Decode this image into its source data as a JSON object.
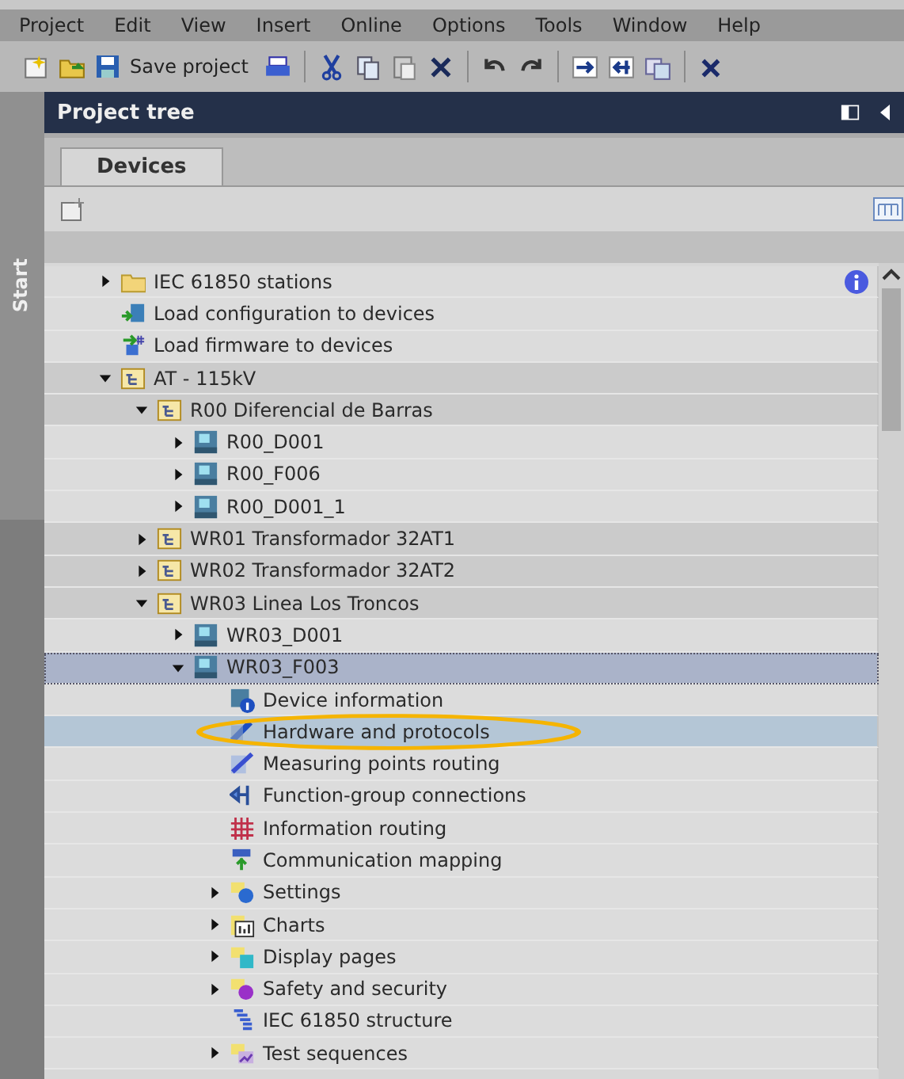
{
  "menu": [
    "Project",
    "Edit",
    "View",
    "Insert",
    "Online",
    "Options",
    "Tools",
    "Window",
    "Help"
  ],
  "toolbar": [
    {
      "kind": "new"
    },
    {
      "kind": "open"
    },
    {
      "kind": "save",
      "label": "Save project"
    },
    {
      "kind": "print"
    },
    {
      "kind": "sep"
    },
    {
      "kind": "cut"
    },
    {
      "kind": "copy"
    },
    {
      "kind": "paste"
    },
    {
      "kind": "delete"
    },
    {
      "kind": "sep"
    },
    {
      "kind": "undo"
    },
    {
      "kind": "redo"
    },
    {
      "kind": "sep"
    },
    {
      "kind": "online"
    },
    {
      "kind": "offline"
    },
    {
      "kind": "devices"
    },
    {
      "kind": "sep"
    },
    {
      "kind": "close"
    }
  ],
  "side_tab": "Start",
  "panel": {
    "title": "Project tree"
  },
  "tabs": [
    {
      "label": "Devices",
      "selected": true
    }
  ],
  "tree": [
    {
      "label": "IEC 61850 stations",
      "kind": "folder",
      "expanded": false,
      "selected": false,
      "hovered": false,
      "circled": false
    },
    {
      "label": "Load configuration to devices",
      "kind": "load-config",
      "selected": false,
      "hovered": false,
      "circled": false
    },
    {
      "label": "Load firmware to devices",
      "kind": "load-firmware",
      "selected": false,
      "hovered": false,
      "circled": false
    },
    {
      "label": "AT - 115kV",
      "kind": "group",
      "expanded": true,
      "selected": false,
      "hovered": false,
      "circled": false,
      "children": [
        {
          "label": "R00 Diferencial de Barras",
          "kind": "group",
          "expanded": true,
          "selected": false,
          "hovered": false,
          "circled": false,
          "children": [
            {
              "label": "R00_D001",
              "kind": "device",
              "expanded": false,
              "selected": false,
              "hovered": false,
              "circled": false
            },
            {
              "label": "R00_F006",
              "kind": "device",
              "expanded": false,
              "selected": false,
              "hovered": false,
              "circled": false
            },
            {
              "label": "R00_D001_1",
              "kind": "device",
              "expanded": false,
              "selected": false,
              "hovered": false,
              "circled": false
            }
          ]
        },
        {
          "label": "WR01 Transformador 32AT1",
          "kind": "group",
          "expanded": false,
          "selected": false,
          "hovered": false,
          "circled": false
        },
        {
          "label": "WR02 Transformador 32AT2",
          "kind": "group",
          "expanded": false,
          "selected": false,
          "hovered": false,
          "circled": false
        },
        {
          "label": "WR03 Linea Los Troncos",
          "kind": "group",
          "expanded": true,
          "selected": false,
          "hovered": false,
          "circled": false,
          "children": [
            {
              "label": "WR03_D001",
              "kind": "device",
              "expanded": false,
              "selected": false,
              "hovered": false,
              "circled": false
            },
            {
              "label": "WR03_F003",
              "kind": "device",
              "expanded": true,
              "selected": true,
              "hovered": false,
              "circled": false,
              "children": [
                {
                  "label": "Device information",
                  "kind": "device-info",
                  "selected": false,
                  "hovered": false,
                  "circled": false
                },
                {
                  "label": "Hardware and protocols",
                  "kind": "hardware",
                  "selected": false,
                  "hovered": true,
                  "circled": true
                },
                {
                  "label": "Measuring points routing",
                  "kind": "measuring",
                  "selected": false,
                  "hovered": false,
                  "circled": false
                },
                {
                  "label": "Function-group connections",
                  "kind": "function",
                  "selected": false,
                  "hovered": false,
                  "circled": false
                },
                {
                  "label": "Information routing",
                  "kind": "routing",
                  "selected": false,
                  "hovered": false,
                  "circled": false
                },
                {
                  "label": "Communication mapping",
                  "kind": "mapping",
                  "selected": false,
                  "hovered": false,
                  "circled": false
                },
                {
                  "label": "Settings",
                  "kind": "settings",
                  "expanded": false,
                  "selected": false,
                  "hovered": false,
                  "circled": false
                },
                {
                  "label": "Charts",
                  "kind": "charts",
                  "expanded": false,
                  "selected": false,
                  "hovered": false,
                  "circled": false
                },
                {
                  "label": "Display pages",
                  "kind": "display",
                  "expanded": false,
                  "selected": false,
                  "hovered": false,
                  "circled": false
                },
                {
                  "label": "Safety and security",
                  "kind": "safety",
                  "expanded": false,
                  "selected": false,
                  "hovered": false,
                  "circled": false
                },
                {
                  "label": "IEC 61850 structure",
                  "kind": "structure",
                  "selected": false,
                  "hovered": false,
                  "circled": false
                },
                {
                  "label": "Test sequences",
                  "kind": "test",
                  "expanded": false,
                  "selected": false,
                  "hovered": false,
                  "circled": false
                }
              ]
            }
          ]
        }
      ]
    }
  ]
}
